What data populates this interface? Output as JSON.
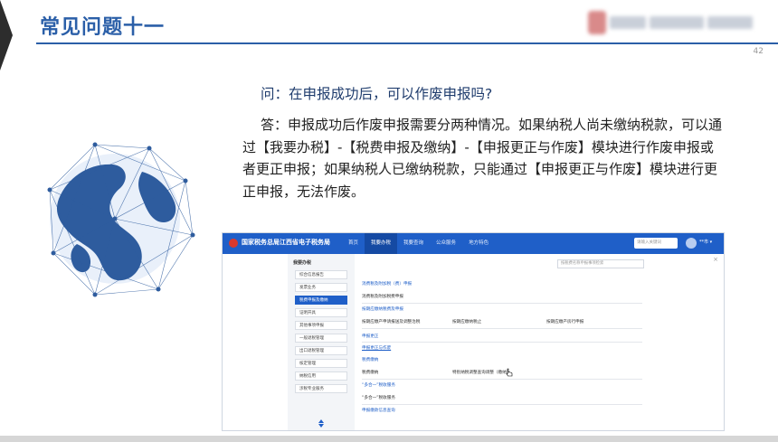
{
  "slide": {
    "title": "常见问题十一",
    "page_number": "42"
  },
  "qa": {
    "question": "问：在申报成功后，可以作废申报吗?",
    "answer": "答：申报成功后作废申报需要分两种情况。如果纳税人尚未缴纳税款，可以通过【我要办税】-【税费申报及缴纳】-【申报更正与作废】模块进行作废申报或者更正申报；如果纳税人已缴纳税款，只能通过【申报更正与作废】模块进行更正申报，无法作废。"
  },
  "app": {
    "title": "国家税务总局江西省电子税务局",
    "nav": [
      "首页",
      "我要办税",
      "我要查询",
      "公众服务",
      "地方特色"
    ],
    "search_placeholder": "请输入关键词",
    "user": "**市 ▾",
    "sidebar": {
      "header": "我要办税",
      "items": [
        "综合信息报告",
        "发票业务",
        "税费申报及缴纳",
        "证明开具",
        "其他事项申报",
        "一般退税管理",
        "出口退税管理",
        "核定管理",
        "纳税信用",
        "涉税专业服务"
      ]
    },
    "main": {
      "search_placeholder": "按税费名称申报事项检索",
      "close": "×",
      "sections": [
        {
          "heading": "消费税及附加税（费）申报",
          "items": [
            "消费税及附加税费申报"
          ]
        },
        {
          "heading": "按期应缴纳税费及申报",
          "items": [
            "按期应缴产申请报送及调整治税",
            "按期应缴纳税止",
            "按期应缴产房行申报"
          ]
        },
        {
          "heading": "申报更正",
          "items": []
        },
        {
          "heading": "申报更正与作废",
          "items": []
        },
        {
          "heading": "税费缴纳",
          "items": [
            "税费缴纳",
            "特别纳税调整查询调整（缴纳）"
          ]
        },
        {
          "heading": "“多合一”税收服务",
          "items": [
            "“多合一”税收服务"
          ]
        },
        {
          "heading": "申报缴款信息查询",
          "items": []
        }
      ]
    }
  },
  "colors": {
    "title_blue": "#2b5fa8",
    "app_blue": "#1f5fc8"
  }
}
